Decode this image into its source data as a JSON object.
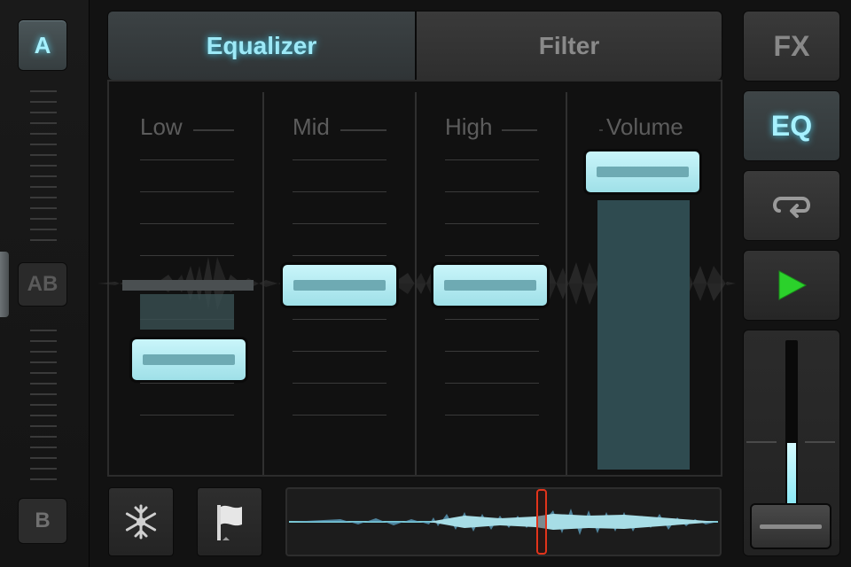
{
  "deck_strip": {
    "deck_a_label": "A",
    "deck_ab_label": "AB",
    "deck_b_label": "B"
  },
  "tabs": [
    {
      "label": "Equalizer",
      "active": true
    },
    {
      "label": "Filter",
      "active": false
    }
  ],
  "eq": {
    "bands": [
      {
        "label": "Low",
        "level": -0.55
      },
      {
        "label": "Mid",
        "level": 0.0
      },
      {
        "label": "High",
        "level": 0.0
      },
      {
        "label": "Volume",
        "level": 1.0
      }
    ]
  },
  "toolbar": {
    "settings_icon": "snowflake-icon",
    "cue_icon": "flag-icon"
  },
  "side": {
    "fx_label": "FX",
    "eq_label": "EQ",
    "loop_icon": "loop-icon",
    "play_icon": "play-icon",
    "pitch_level": 0.2
  },
  "colors": {
    "accent": "#9de9f7",
    "knob": "#b8eef5",
    "playhead": "#e2341b",
    "play": "#2bd12b"
  }
}
